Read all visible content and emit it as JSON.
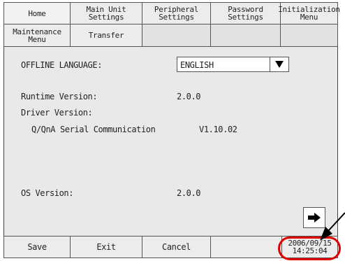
{
  "tabs_row1": [
    {
      "label": "Home"
    },
    {
      "label": "Main Unit\nSettings"
    },
    {
      "label": "Peripheral\nSettings"
    },
    {
      "label": "Password\nSettings"
    },
    {
      "label": "Initialization\nMenu"
    }
  ],
  "tabs_row2": [
    {
      "label": "Maintenance\nMenu"
    },
    {
      "label": "Transfer"
    }
  ],
  "settings": {
    "language_label": "OFFLINE LANGUAGE:",
    "language_value": "ENGLISH",
    "runtime_label": "Runtime Version:",
    "runtime_value": "2.0.0",
    "driver_label": "Driver Version:",
    "driver_name": "Q/QnA Serial Communication",
    "driver_value": "V1.10.02",
    "os_label": "OS Version:",
    "os_value": "2.0.0"
  },
  "footer": {
    "save": "Save",
    "exit": "Exit",
    "cancel": "Cancel",
    "date": "2006/09/15",
    "time": "14:25:04"
  },
  "icons": {
    "dropdown": "triangle-down-icon",
    "next": "arrow-right-icon",
    "callout": "black-pointer-arrow"
  },
  "colors": {
    "highlight_ring": "#e00000"
  }
}
